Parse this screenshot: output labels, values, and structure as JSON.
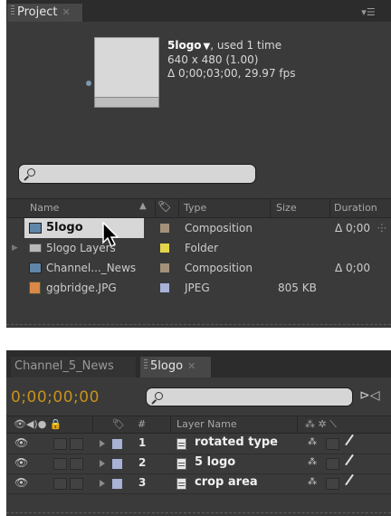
{
  "project": {
    "tab_label": "Project",
    "info": {
      "name": "5logo",
      "usage": ", used 1 time",
      "dimensions": "640 x 480 (1.00)",
      "duration_line": "Δ 0;00;03;00, 29.97 fps"
    },
    "search": {
      "value": ""
    },
    "columns": {
      "name": "Name",
      "type": "Type",
      "size": "Size",
      "duration": "Duration"
    },
    "items": [
      {
        "name": "5logo",
        "type": "Composition",
        "size": "",
        "duration": "Δ 0;00",
        "icon": "composition-icon",
        "label_color": "#a3917a"
      },
      {
        "name": "5logo Layers",
        "type": "Folder",
        "size": "",
        "duration": "",
        "icon": "folder-icon",
        "label_color": "#e2d54c"
      },
      {
        "name": "Channel..._News",
        "type": "Composition",
        "size": "",
        "duration": "Δ 0;00",
        "icon": "composition-icon",
        "label_color": "#a3917a"
      },
      {
        "name": "ggbridge.JPG",
        "type": "JPEG",
        "size": "805 KB",
        "duration": "",
        "icon": "image-icon",
        "label_color": "#a8b2d6"
      }
    ]
  },
  "timeline": {
    "tabs": [
      {
        "label": "Channel_5_News"
      },
      {
        "label": "5logo"
      }
    ],
    "timecode": "0;00;00;00",
    "search": {
      "value": ""
    },
    "columns": {
      "number": "#",
      "layer_name": "Layer Name"
    },
    "layers": [
      {
        "number": "1",
        "name": "rotated type",
        "label_color": "#a8b2d6"
      },
      {
        "number": "2",
        "name": "5 logo",
        "label_color": "#a8b2d6"
      },
      {
        "number": "3",
        "name": "crop area",
        "label_color": "#a8b2d6"
      }
    ]
  },
  "colors": {
    "timecode": "#c8911a",
    "panel_bg": "#3a3a3a",
    "selection": "#d7d7d7"
  }
}
